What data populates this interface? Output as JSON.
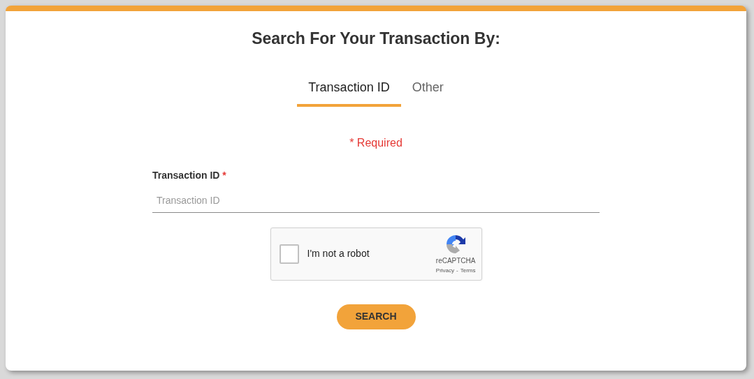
{
  "title": "Search For Your Transaction By:",
  "tabs": [
    {
      "label": "Transaction ID",
      "selected": true
    },
    {
      "label": "Other",
      "selected": false
    }
  ],
  "required_note": "* Required",
  "field": {
    "label": "Transaction ID",
    "required_mark": "*",
    "placeholder": "Transaction ID"
  },
  "captcha": {
    "label": "I'm not a robot",
    "checked": false,
    "brand": "reCAPTCHA",
    "privacy": "Privacy",
    "separator": "-",
    "terms": "Terms"
  },
  "button": "SEARCH"
}
